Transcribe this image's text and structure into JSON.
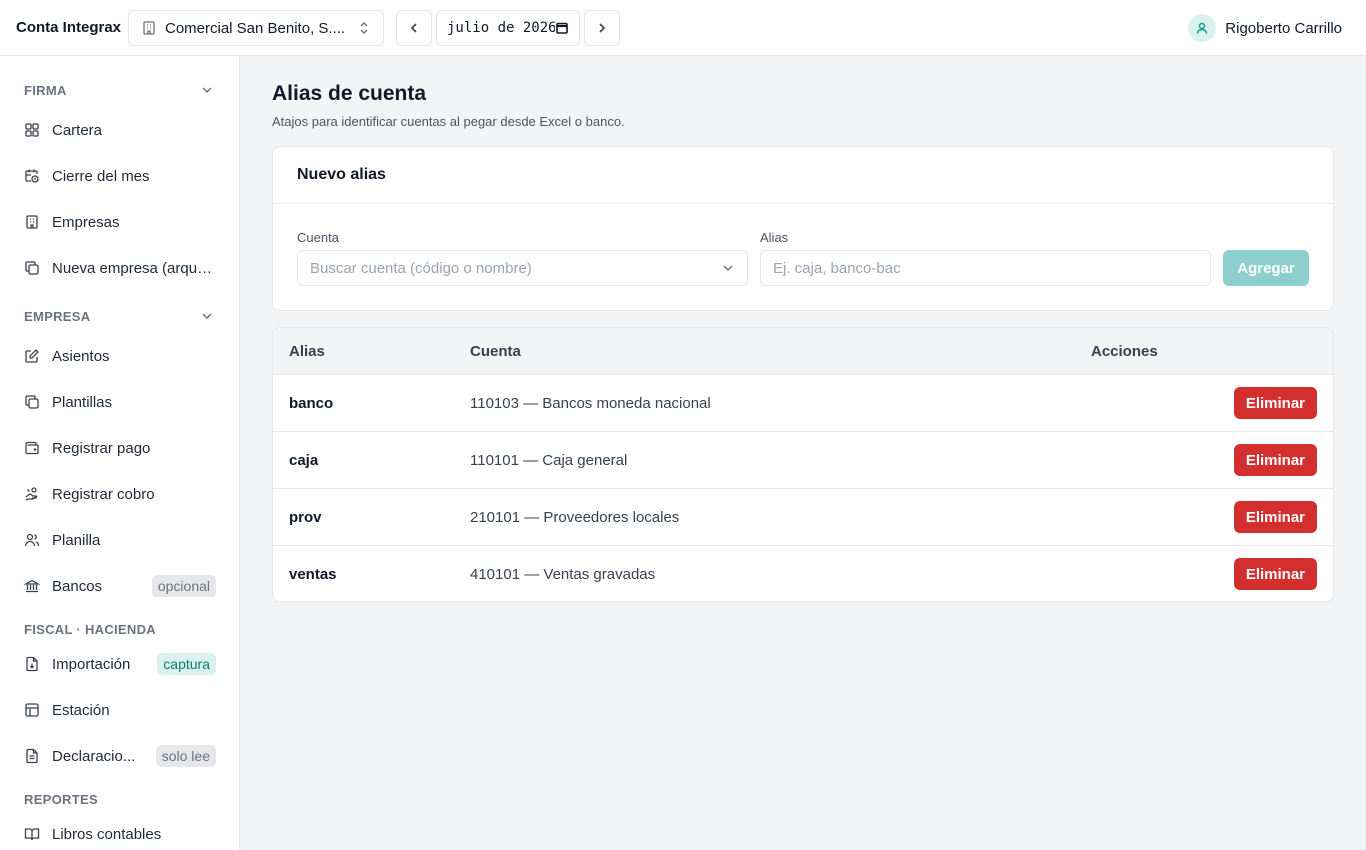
{
  "header": {
    "brand": "Conta Integrax",
    "company": "Comercial San Benito, S....",
    "month_value": "julio de 2026",
    "user_name": "Rigoberto Carrillo"
  },
  "sidebar": {
    "sections": [
      {
        "label": "FIRMA"
      },
      {
        "label": "EMPRESA"
      },
      {
        "label": "FISCAL · HACIENDA"
      },
      {
        "label": "REPORTES"
      }
    ],
    "items": [
      {
        "label": "Cartera",
        "icon": "grid-icon"
      },
      {
        "label": "Cierre del mes",
        "icon": "calendar-clock-icon"
      },
      {
        "label": "Empresas",
        "icon": "building-icon"
      },
      {
        "label": "Nueva empresa (arque...",
        "icon": "copy-icon"
      },
      {
        "label": "Asientos",
        "icon": "edit-icon"
      },
      {
        "label": "Plantillas",
        "icon": "copy-icon"
      },
      {
        "label": "Registrar pago",
        "icon": "wallet-icon"
      },
      {
        "label": "Registrar cobro",
        "icon": "hand-coins-icon"
      },
      {
        "label": "Planilla",
        "icon": "users-icon"
      },
      {
        "label": "Bancos",
        "icon": "bank-icon",
        "badge": "opcional"
      },
      {
        "label": "Importación",
        "icon": "file-download-icon",
        "badge": "captura"
      },
      {
        "label": "Estación",
        "icon": "table-icon"
      },
      {
        "label": "Declaracio...",
        "icon": "file-text-icon",
        "badge": "solo lee"
      },
      {
        "label": "Libros contables",
        "icon": "book-icon"
      }
    ]
  },
  "main": {
    "title": "Alias de cuenta",
    "subtitle": "Atajos para identificar cuentas al pegar desde Excel o banco.",
    "form": {
      "title": "Nuevo alias",
      "account_label": "Cuenta",
      "account_placeholder": "Buscar cuenta (código o nombre)",
      "alias_label": "Alias",
      "alias_placeholder": "Ej. caja, banco-bac",
      "add_label": "Agregar"
    },
    "table": {
      "columns": [
        "Alias",
        "Cuenta",
        "Acciones"
      ],
      "delete_label": "Eliminar",
      "rows": [
        {
          "alias": "banco",
          "account": "110103 — Bancos moneda nacional"
        },
        {
          "alias": "caja",
          "account": "110101 — Caja general"
        },
        {
          "alias": "prov",
          "account": "210101 — Proveedores locales"
        },
        {
          "alias": "ventas",
          "account": "410101 — Ventas gravadas"
        }
      ]
    }
  },
  "colors": {
    "accent": "#0f9d8e",
    "add_button": "#8ccfcd",
    "danger": "#d32f2f"
  }
}
